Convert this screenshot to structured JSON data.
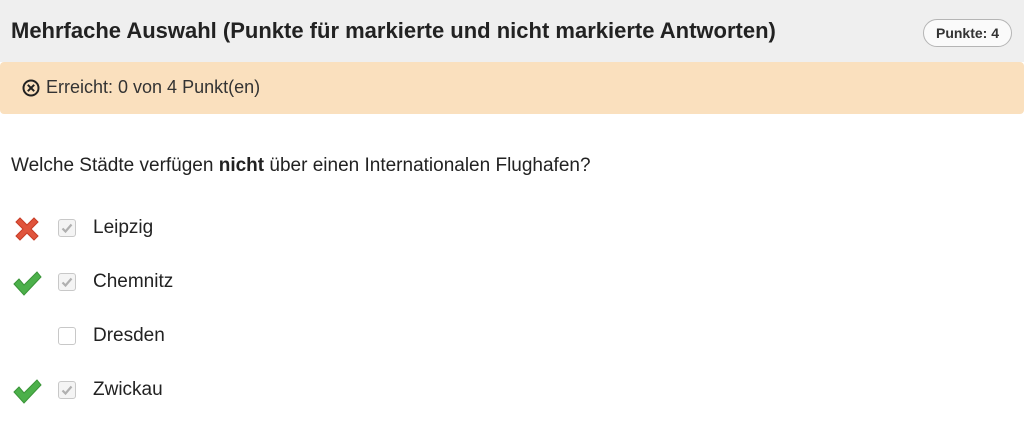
{
  "header": {
    "title": "Mehrfache Auswahl (Punkte für markierte und nicht markierte Antworten)",
    "points_badge": "Punkte: 4"
  },
  "status": {
    "icon": "circled-x-icon",
    "text": "Erreicht: 0 von 4 Punkt(en)",
    "background": "#fae0be"
  },
  "question": {
    "before": "Welche Städte verfügen ",
    "bold": "nicht",
    "after": " über einen Internationalen Flughafen?"
  },
  "options": [
    {
      "label": "Leipzig",
      "checked": true,
      "mark": "red-x-icon"
    },
    {
      "label": "Chemnitz",
      "checked": true,
      "mark": "green-check-icon"
    },
    {
      "label": "Dresden",
      "checked": false,
      "mark": ""
    },
    {
      "label": "Zwickau",
      "checked": true,
      "mark": "green-check-icon"
    }
  ],
  "colors": {
    "wrong": "#e0543c",
    "correct": "#4cb04a",
    "checkbox_tick": "#b0b0b0"
  }
}
